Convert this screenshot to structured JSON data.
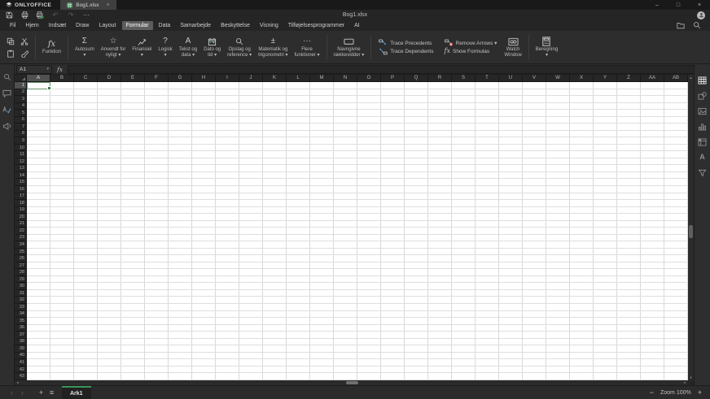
{
  "colors": {
    "accent_green": "#3a9757",
    "selection_border": "#67936f",
    "remove_arrows_red": "#c75050",
    "trace_arrow_blue": "#6ba4d9",
    "sheet_background": "#ffffff",
    "ui_background": "#2d2d2d"
  },
  "titlebar": {
    "app_name": "ONLYOFFICE",
    "document_tab": {
      "label": "Bog1.xlsx",
      "close_label": "×"
    },
    "window_controls": {
      "minimize": "–",
      "maximize": "□",
      "close": "×"
    }
  },
  "toolbar": {
    "document_title": "Bog1.xlsx",
    "quick_access": [
      {
        "name": "save",
        "disabled": false
      },
      {
        "name": "print",
        "disabled": false
      },
      {
        "name": "quick-print",
        "disabled": false
      },
      {
        "name": "undo",
        "disabled": true
      },
      {
        "name": "redo",
        "disabled": true
      },
      {
        "name": "more",
        "disabled": false
      }
    ]
  },
  "menu": {
    "tabs": [
      {
        "label": "Fil",
        "active": false
      },
      {
        "label": "Hjem",
        "active": false
      },
      {
        "label": "Indsæt",
        "active": false
      },
      {
        "label": "Draw",
        "active": false
      },
      {
        "label": "Layout",
        "active": false
      },
      {
        "label": "Formular",
        "active": true
      },
      {
        "label": "Data",
        "active": false
      },
      {
        "label": "Samarbejde",
        "active": false
      },
      {
        "label": "Beskyttelse",
        "active": false
      },
      {
        "label": "Visning",
        "active": false
      },
      {
        "label": "Tilføjelsesprogrammer",
        "active": false
      },
      {
        "label": "AI",
        "active": false
      }
    ],
    "right_icons": [
      "open-file-location",
      "search"
    ]
  },
  "ribbon": {
    "edit_buttons": [
      "copy",
      "cut",
      "paste",
      "copy-style"
    ],
    "function_button": {
      "label": "Funktion",
      "icon": "fx"
    },
    "dropdown_buttons": [
      {
        "name": "autosum",
        "icon": "sigma",
        "lines": [
          "Autosum",
          "▾"
        ]
      },
      {
        "name": "recently-used",
        "icon": "star",
        "lines": [
          "Anvendt for",
          "nyligt ▾"
        ]
      },
      {
        "name": "financial",
        "icon": "finance",
        "lines": [
          "Finansiel",
          "▾"
        ]
      },
      {
        "name": "logical",
        "icon": "question",
        "lines": [
          "Logisk",
          "▾"
        ]
      },
      {
        "name": "text-data",
        "icon": "letter-a",
        "lines": [
          "Tekst og",
          "data ▾"
        ]
      },
      {
        "name": "date-time",
        "icon": "calendar",
        "lines": [
          "Dato og",
          "tid ▾"
        ]
      },
      {
        "name": "lookup-reference",
        "icon": "magnifier",
        "lines": [
          "Opslag og",
          "reference ▾"
        ]
      },
      {
        "name": "math-trig",
        "icon": "plus-minus",
        "lines": [
          "Matematik og",
          "trigonometri ▾"
        ]
      },
      {
        "name": "more-functions",
        "icon": "dots",
        "lines": [
          "Flere",
          "funktioner ▾"
        ]
      }
    ],
    "named_ranges": {
      "icon": "named-range",
      "lines": [
        "Navngivne",
        "rækkevidder ▾"
      ]
    },
    "trace_buttons": [
      {
        "name": "trace-precedents",
        "icon": "trace-precedents",
        "label": "Trace Precedents"
      },
      {
        "name": "trace-dependents",
        "icon": "trace-dependents",
        "label": "Trace Dependents"
      },
      {
        "name": "remove-arrows",
        "icon": "remove-arrows",
        "label": "Remove Arrows ▾"
      },
      {
        "name": "show-formulas",
        "icon": "show-formulas",
        "label": "Show Formulas"
      }
    ],
    "watch_window": {
      "icon": "watch",
      "lines": [
        "Watch",
        "Window"
      ]
    },
    "calculation": {
      "icon": "calculator",
      "lines": [
        "Beregning",
        "▾"
      ]
    }
  },
  "formula_bar": {
    "name_box_value": "A1",
    "fx_label": "fx",
    "input_value": ""
  },
  "left_sidebar": {
    "icons": [
      "search",
      "comments",
      "spellcheck",
      "feedback"
    ]
  },
  "right_sidebar": {
    "icons": [
      "cell-settings",
      "shape-settings",
      "image-settings",
      "chart-settings",
      "pivot-settings",
      "text-art-settings",
      "slicer-settings"
    ]
  },
  "grid": {
    "selected_cell": "A1",
    "columns": [
      "A",
      "B",
      "C",
      "D",
      "E",
      "F",
      "G",
      "H",
      "I",
      "J",
      "K",
      "L",
      "M",
      "N",
      "O",
      "P",
      "Q",
      "R",
      "S",
      "T",
      "U",
      "V",
      "W",
      "X",
      "Y",
      "Z",
      "AA",
      "AB"
    ],
    "rows": [
      "1",
      "2",
      "3",
      "4",
      "5",
      "6",
      "7",
      "8",
      "9",
      "10",
      "11",
      "12",
      "13",
      "14",
      "15",
      "16",
      "17",
      "18",
      "19",
      "20",
      "21",
      "22",
      "23",
      "24",
      "25",
      "26",
      "27",
      "28",
      "29",
      "30",
      "31",
      "32",
      "33",
      "34",
      "35",
      "36",
      "37",
      "38",
      "39",
      "40",
      "41",
      "42",
      "43"
    ]
  },
  "sheet_bar": {
    "nav_prev": "‹",
    "nav_next": "›",
    "add_sheet": "+",
    "sheet_list": "≡",
    "tabs": [
      {
        "label": "Ark1",
        "active": true
      }
    ],
    "zoom": {
      "minus": "−",
      "label": "Zoom 100%",
      "plus": "+"
    }
  }
}
